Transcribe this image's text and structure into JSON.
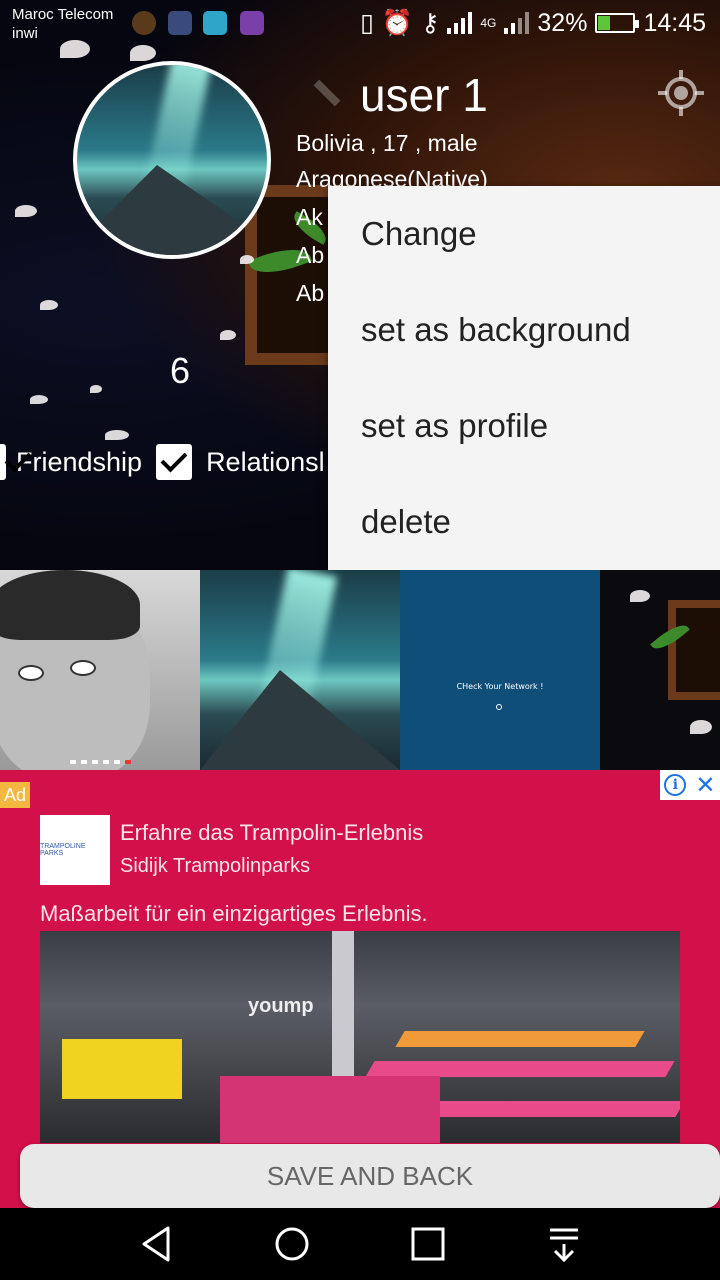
{
  "status_bar": {
    "carrier_1": "Maroc Telecom",
    "carrier_2": "inwi",
    "network": "4G",
    "battery_percent": "32%",
    "battery_level": 0.32,
    "time": "14:45"
  },
  "profile": {
    "username": "user 1",
    "info_lines": [
      "Bolivia , 17 , male",
      "Aragonese(Native)",
      "Ak",
      "Ab",
      "Ab"
    ],
    "count": "6"
  },
  "checkboxes": [
    {
      "label": "Friendship",
      "checked": true
    },
    {
      "label": "Relationsl",
      "checked": true
    }
  ],
  "context_menu": {
    "items": [
      "Change",
      "set as background",
      "set as profile",
      "delete"
    ]
  },
  "photos": {
    "network_message": "CHeck Your Network !"
  },
  "ad": {
    "badge": "Ad",
    "info_icon": "i",
    "close_icon": "✕",
    "logo_text": "TRAMPOLINE PARKS",
    "title": "Erfahre das Trampolin-Erlebnis",
    "advertiser": "Sidijk Trampolinparks",
    "description": "Maßarbeit für ein einzigartiges Erlebnis.",
    "image_brand": "yoump"
  },
  "actions": {
    "save_back_label": "SAVE AND BACK"
  },
  "nav_bar": {
    "icons": [
      "back-icon",
      "home-icon",
      "recents-icon",
      "notification-pull-icon"
    ]
  }
}
